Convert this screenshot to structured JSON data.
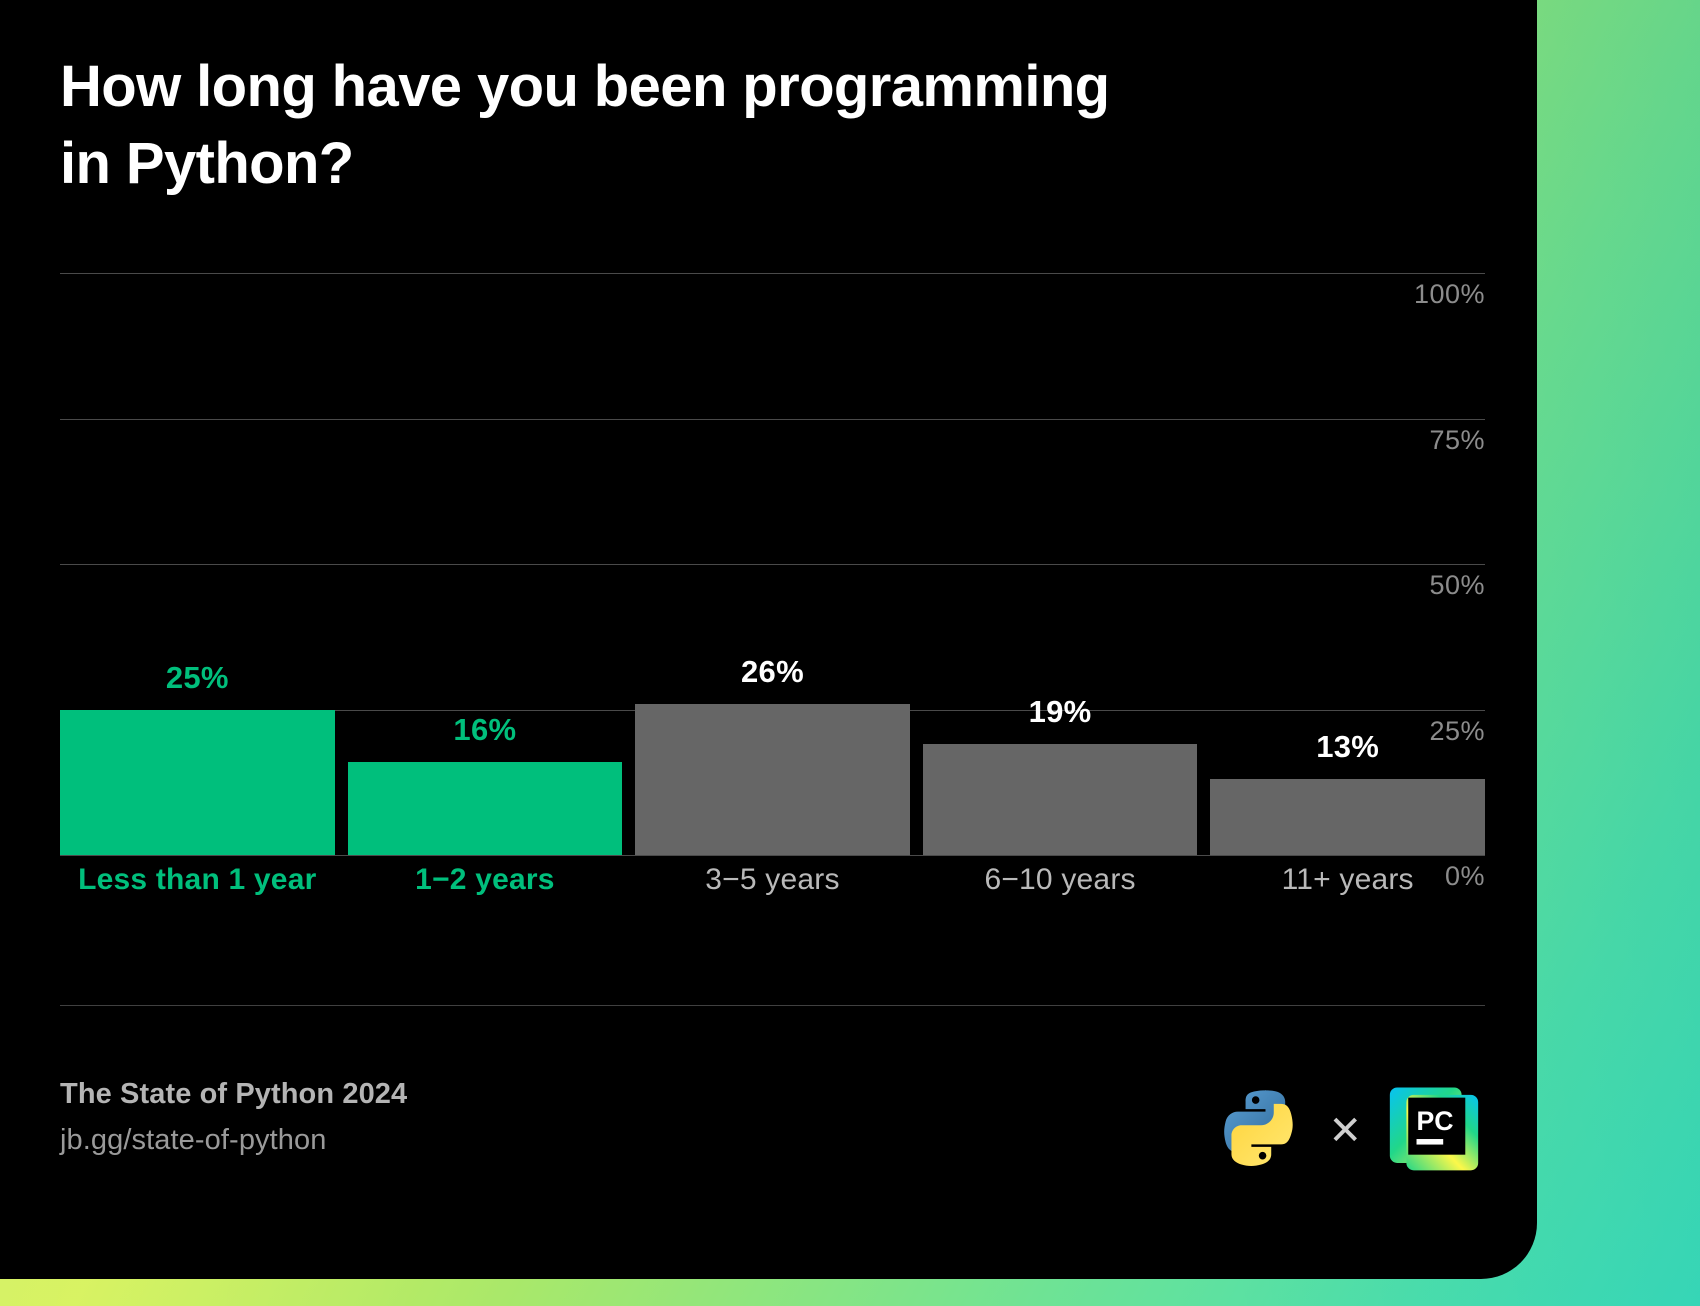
{
  "title": "How long have you been programming\nin Python?",
  "footer": {
    "report": "The State of Python 2024",
    "url": "jb.gg/state-of-python",
    "cross_glyph": "✕",
    "python_logo_alt": "python-logo",
    "pycharm_logo_alt": "pycharm-logo",
    "pycharm_text": "PC"
  },
  "colors": {
    "accent_green": "#00bf7c",
    "bar_gray": "#666666",
    "card_bg": "#000000",
    "grid": "#4a4a4a",
    "tick_text": "#8c8c8c",
    "category_text": "#b9b9b9"
  },
  "chart_data": {
    "type": "bar",
    "title": "How long have you been programming in Python?",
    "xlabel": "",
    "ylabel": "",
    "ylim": [
      0,
      100
    ],
    "yticks": [
      "0%",
      "25%",
      "50%",
      "75%",
      "100%"
    ],
    "ytick_values": [
      0,
      25,
      50,
      75,
      100
    ],
    "grid": true,
    "legend": "none",
    "categories": [
      "Less than 1 year",
      "1−2 years",
      "3−5 years",
      "6−10 years",
      "11+ years"
    ],
    "values": [
      25,
      16,
      26,
      19,
      13
    ],
    "value_labels": [
      "25%",
      "16%",
      "26%",
      "19%",
      "13%"
    ],
    "highlighted": [
      true,
      true,
      false,
      false,
      false
    ],
    "bar_widths_rel": [
      1.0,
      1.0,
      1.0,
      1.0,
      1.0
    ]
  }
}
